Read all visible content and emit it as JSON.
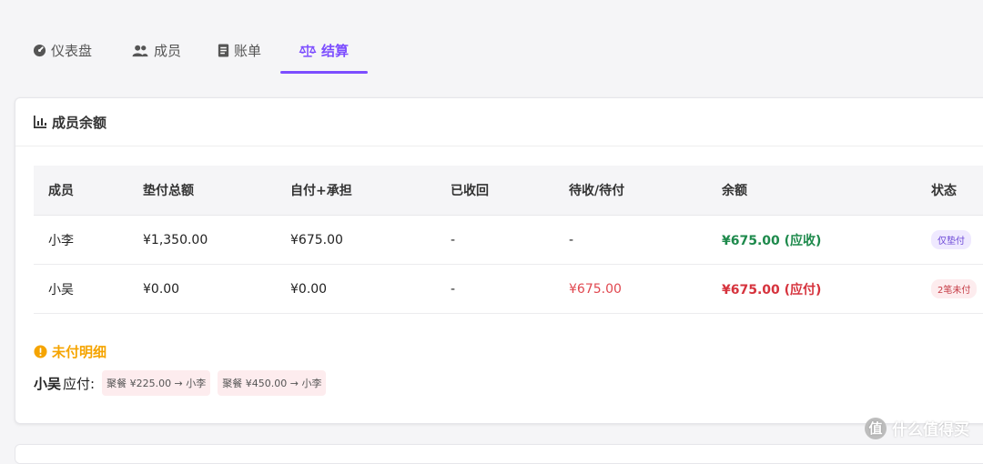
{
  "tabs": [
    {
      "label": "仪表盘",
      "icon": "dashboard-icon"
    },
    {
      "label": "成员",
      "icon": "users-icon"
    },
    {
      "label": "账单",
      "icon": "receipt-icon"
    },
    {
      "label": "结算",
      "icon": "scale-icon",
      "active": true
    }
  ],
  "colors": {
    "accent": "#7c4dff",
    "positive": "#1e8a4c",
    "negative": "#d6333d",
    "warning": "#f5a400"
  },
  "balance_card": {
    "title": "成员余额",
    "title_icon": "bar-chart-icon",
    "columns": [
      "成员",
      "垫付总额",
      "自付+承担",
      "已收回",
      "待收/待付",
      "余额",
      "状态"
    ],
    "rows": [
      {
        "member": "小李",
        "advanced": "¥1,350.00",
        "own_share": "¥675.00",
        "recovered": "-",
        "pending": "-",
        "balance": "¥675.00 (应收)",
        "status": "仅垫付"
      },
      {
        "member": "小吴",
        "advanced": "¥0.00",
        "own_share": "¥0.00",
        "recovered": "-",
        "pending": "¥675.00",
        "balance": "¥675.00 (应付)",
        "status": "2笔未付"
      }
    ]
  },
  "unpaid": {
    "title": "未付明细",
    "icon": "warning-circle-icon",
    "payer": "小吴",
    "payer_suffix": "应付:",
    "items": [
      "聚餐 ¥225.00 → 小李",
      "聚餐 ¥450.00 → 小李"
    ]
  },
  "watermark": {
    "text": "什么值得买",
    "logo_glyph": "值"
  }
}
